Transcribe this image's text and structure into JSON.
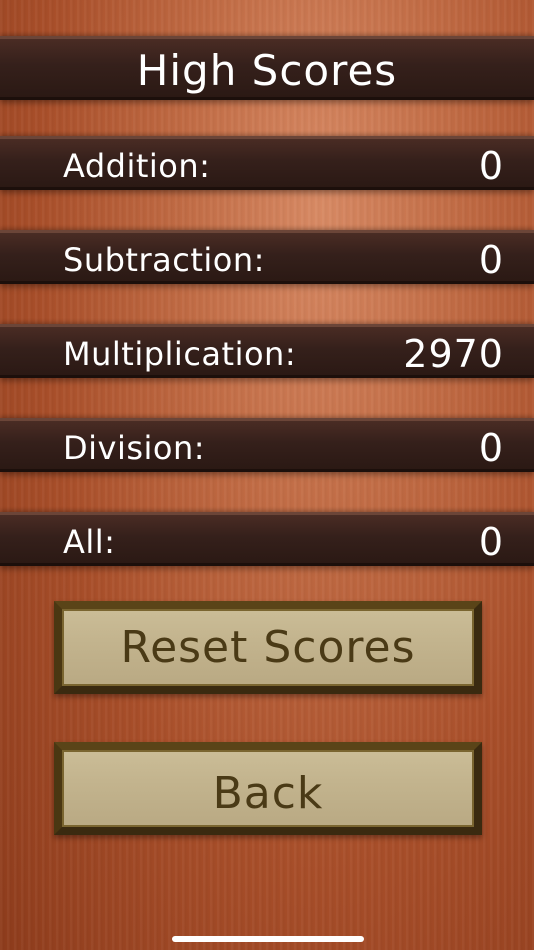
{
  "title": "High Scores",
  "scores": [
    {
      "label": "Addition:",
      "value": "0"
    },
    {
      "label": "Subtraction:",
      "value": "0"
    },
    {
      "label": "Multiplication:",
      "value": "2970"
    },
    {
      "label": "Division:",
      "value": "0"
    },
    {
      "label": "All:",
      "value": "0"
    }
  ],
  "buttons": {
    "reset": "Reset Scores",
    "back": "Back"
  }
}
